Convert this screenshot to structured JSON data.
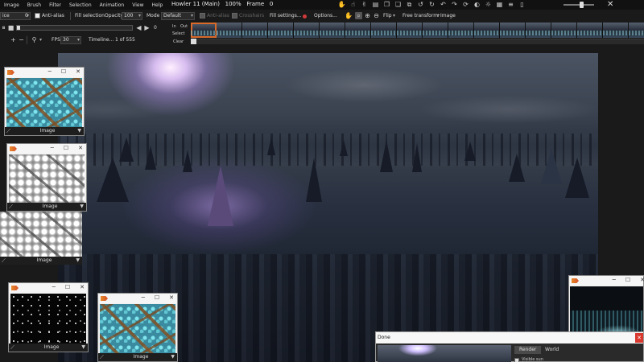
{
  "menubar": {
    "items": [
      "Image",
      "Brush",
      "Filter",
      "Selection",
      "Animation",
      "View",
      "Help"
    ],
    "title": "Howler 11 (Main)",
    "zoom": "100%",
    "frame_label": "Frame",
    "frame_value": "0"
  },
  "toolbar": {
    "brush_select": "ice",
    "brush_size": "0",
    "antialias_label": "Anti-alias",
    "fill_selection_label": "Fill selection",
    "opacity_label": "Opacity",
    "opacity_value": "100",
    "mode_label": "Mode",
    "mode_value": "Default",
    "antialias2_label": "Anti-alias",
    "crosshairs_label": "Crosshairs",
    "fill_settings_label": "Fill settings...",
    "options_label": "Options...",
    "flip_label": "Flip",
    "free_transform_label": "Free transform",
    "plus_image_label": "+Image"
  },
  "playback": {
    "counter": "0",
    "progress": 0.03,
    "fps_label": "FPS",
    "fps_value": "30",
    "timeline_label": "Timeline...",
    "frame_counter": "1 of 555"
  },
  "timeline": {
    "in_label": "In",
    "out_label": "Out",
    "select_label": "Select",
    "clear_label": "Clear",
    "frame_count": 18,
    "current_frame": 0
  },
  "windows": {
    "win1": {
      "label": "Image",
      "texture": "cyan"
    },
    "win2": {
      "label": "Image",
      "texture": "gray"
    },
    "win3": {
      "label": "Image",
      "texture": "gray"
    },
    "win4": {
      "label": "Image",
      "texture": "dots"
    },
    "win5": {
      "label": "Image",
      "texture": "cyan"
    }
  },
  "done_window": {
    "title": "Done",
    "tabs": [
      "Render",
      "World"
    ],
    "active_tab": "Render",
    "visible_sun_label": "Visible sun"
  },
  "colors": {
    "accent": "#d96a2a",
    "record": "#d23a3a",
    "close": "#d9382e"
  }
}
